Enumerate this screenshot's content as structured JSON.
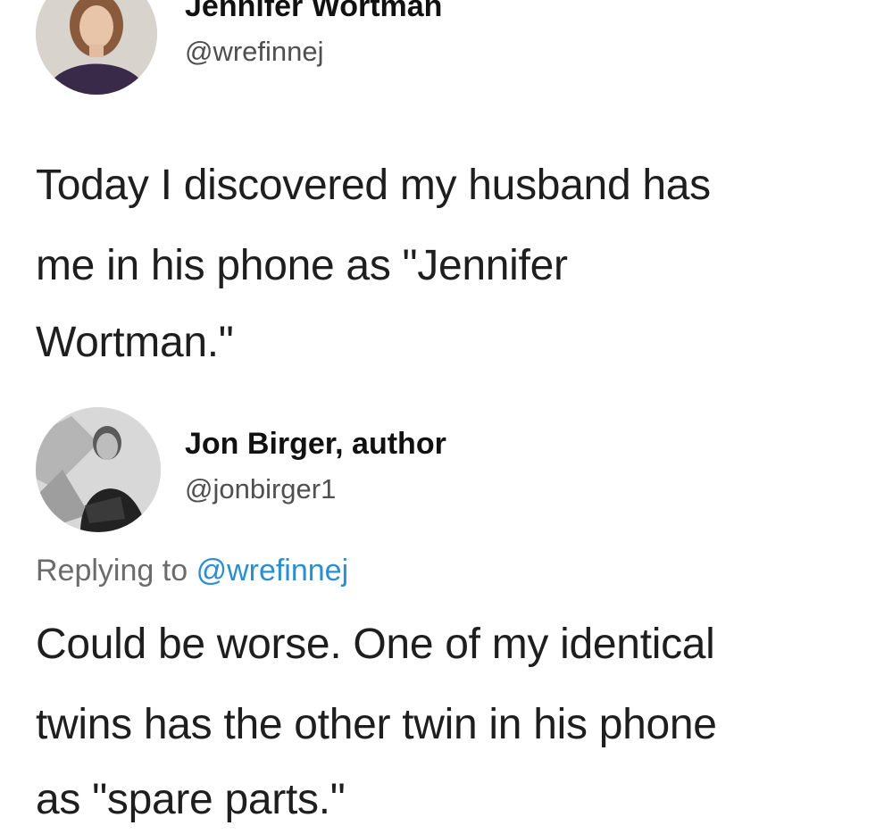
{
  "tweet1": {
    "display_name": "Jennifer Wortman",
    "handle": "@wrefinnej",
    "avatar_icon": "user-photo-avatar",
    "body_lines": [
      "Today I discovered my husband has",
      "me in his phone as \"Jennifer",
      "Wortman.\""
    ]
  },
  "tweet2": {
    "display_name": "Jon Birger, author",
    "handle": "@jonbirger1",
    "avatar_icon": "user-photo-avatar",
    "replying_prefix": "Replying to",
    "replying_mention": "@wrefinnej",
    "body_lines": [
      "Could be worse. One of my identical",
      "twins has the other twin in his phone",
      "as \"spare parts.\""
    ]
  },
  "colors": {
    "background": "#ffffff",
    "text": "#1e1e1e",
    "secondary": "#6b6b6b",
    "link": "#2a8fd1"
  }
}
